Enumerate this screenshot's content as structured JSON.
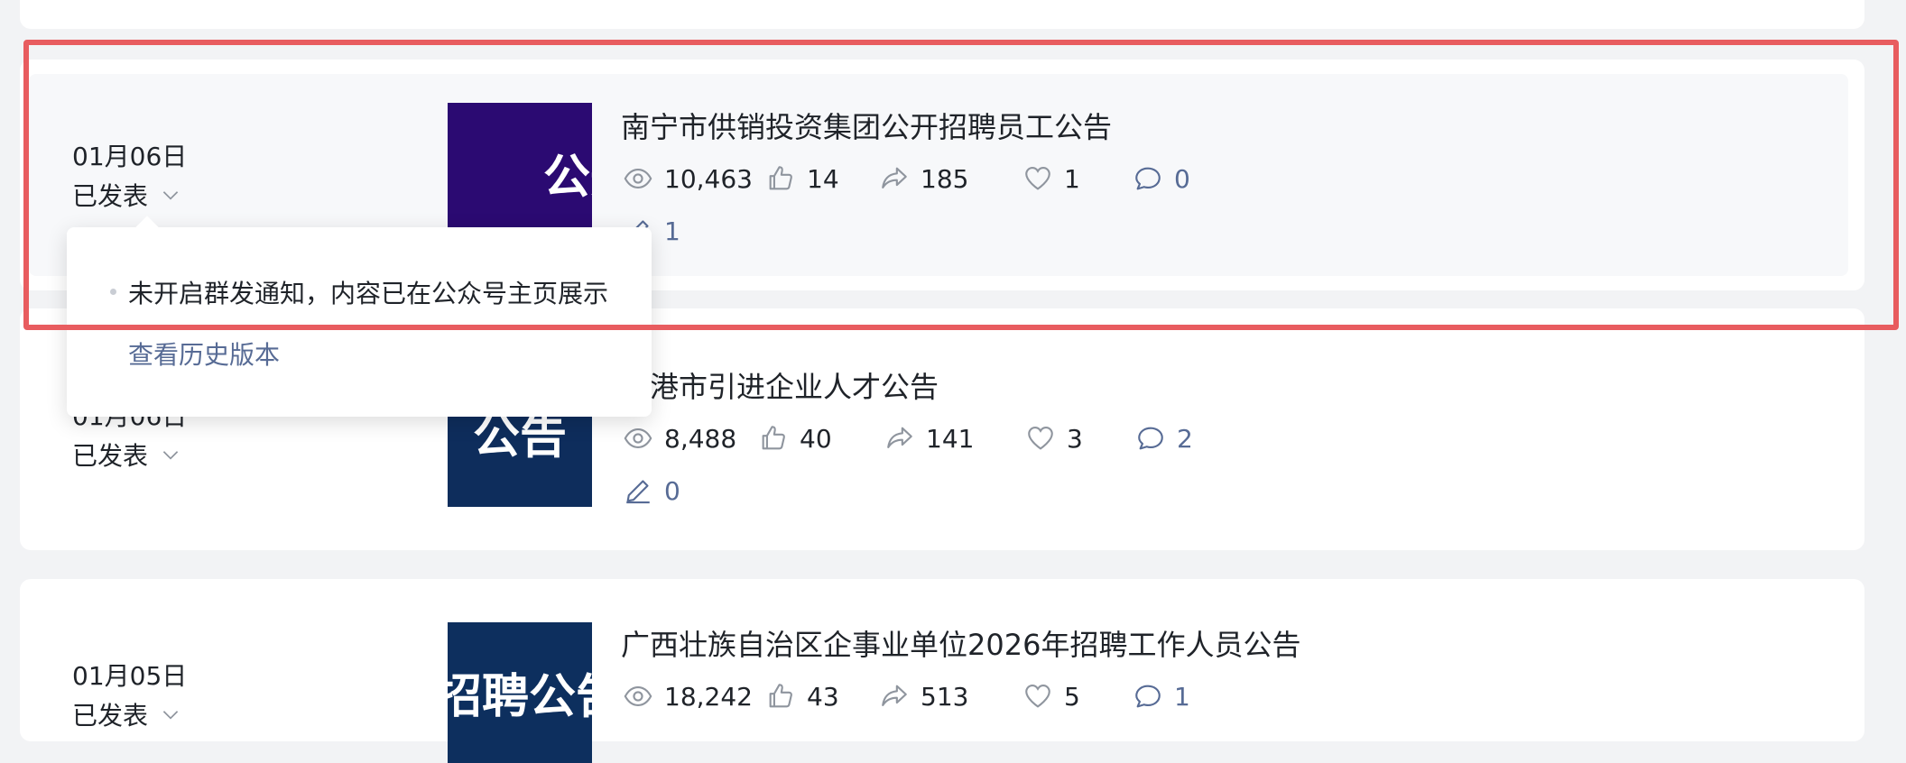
{
  "colors": {
    "page_bg": "#f2f3f5",
    "card_bg": "#ffffff",
    "link": "#576b95",
    "highlight": "#e85c5f"
  },
  "articles": [
    {
      "date": "01月06日",
      "status": "已发表",
      "thumb_text": "公开",
      "thumb_color": "#2b0a72",
      "title": "南宁市供销投资集团公开招聘员工公告",
      "views": "10,463",
      "likes": "14",
      "shares": "185",
      "favorites": "1",
      "comments": "0",
      "edits": "1"
    },
    {
      "date": "01月06日",
      "status": "已发表",
      "thumb_text": "公告",
      "thumb_color": "#0e2d5c",
      "title": "贵港市引进企业人才公告",
      "views": "8,488",
      "likes": "40",
      "shares": "141",
      "favorites": "3",
      "comments": "2",
      "edits": "0"
    },
    {
      "date": "01月05日",
      "status": "已发表",
      "thumb_text": "招聘公告",
      "thumb_color": "#0d2f5e",
      "title": "广西壮族自治区企事业单位2026年招聘工作人员公告",
      "views": "18,242",
      "likes": "43",
      "shares": "513",
      "favorites": "5",
      "comments": "1"
    }
  ],
  "popover": {
    "notice": "未开启群发通知，内容已在公众号主页展示",
    "history_link": "查看历史版本"
  },
  "icons": {
    "views": "eye-icon",
    "likes": "thumbs-up-icon",
    "shares": "share-icon",
    "favorites": "heart-icon",
    "comments": "comment-icon",
    "edits": "pencil-icon",
    "status": "chevron-down-icon"
  }
}
